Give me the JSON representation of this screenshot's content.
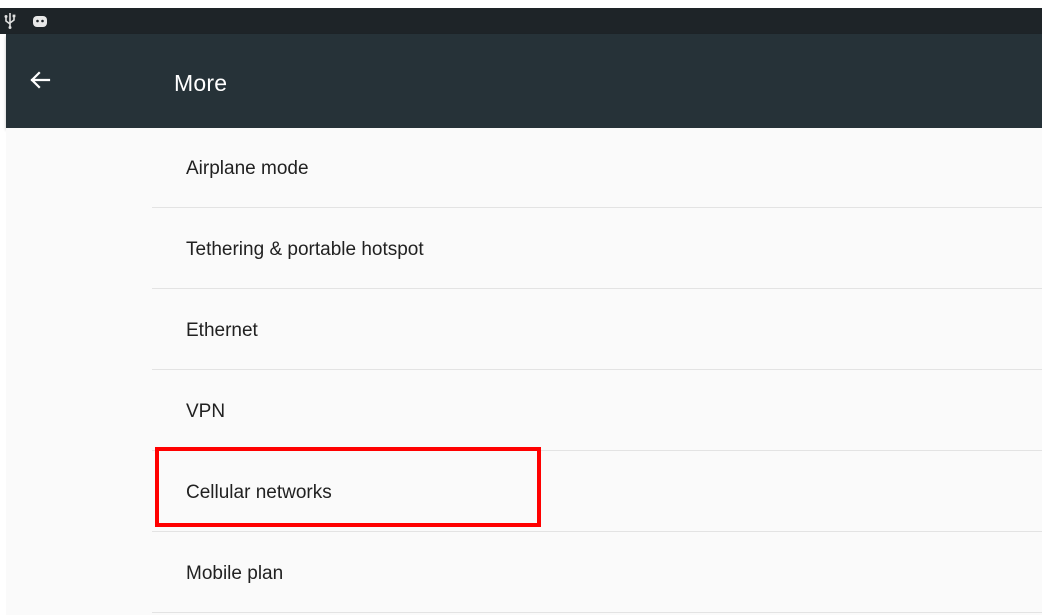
{
  "status_bar": {
    "icons": [
      "usb-icon",
      "android-icon"
    ],
    "background": "#1e2428"
  },
  "app_bar": {
    "title": "More",
    "back_icon": "arrow-left-icon",
    "background": "#263238"
  },
  "settings": {
    "items": [
      {
        "label": "Airplane mode"
      },
      {
        "label": "Tethering & portable hotspot"
      },
      {
        "label": "Ethernet"
      },
      {
        "label": "VPN"
      },
      {
        "label": "Cellular networks",
        "highlighted": true
      },
      {
        "label": "Mobile plan"
      }
    ]
  },
  "highlight_color": "#ff0000"
}
